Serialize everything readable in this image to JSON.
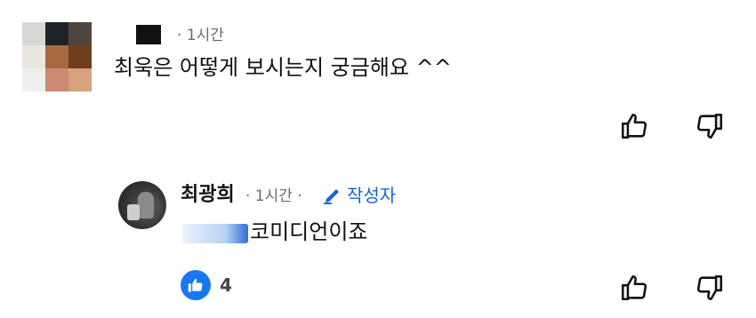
{
  "comment": {
    "author_redacted": "",
    "time": "· 1시간",
    "text": "최욱은 어떻게 보시는지 궁금해요 ^^",
    "avatar_colors": [
      "#d6d9d3",
      "#1f2226",
      "#4e453f",
      "#e9e6e1",
      "#a9683f",
      "#6e3d1c",
      "#eef0ed",
      "#cc8a74",
      "#d7a27c"
    ]
  },
  "reply": {
    "author": "최광희",
    "time": "· 1시간 ·",
    "author_badge": "작성자",
    "text": "코미디언이죠",
    "like_count": "4"
  },
  "colors": {
    "accent": "#1565d8",
    "like_badge": "#1877f2",
    "muted": "#6b6b6b"
  },
  "icons": [
    "thumbs-up-icon",
    "thumbs-down-icon",
    "pencil-icon",
    "like-badge-icon"
  ]
}
